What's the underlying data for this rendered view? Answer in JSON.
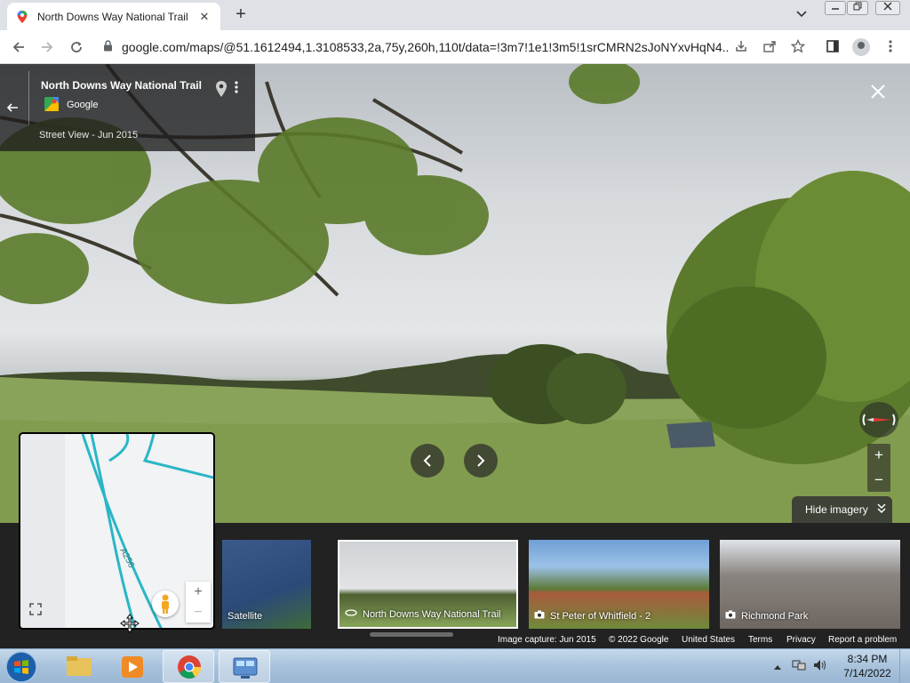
{
  "browser": {
    "tab": {
      "title": "North Downs Way National Trail",
      "close_label": "✕",
      "favicon": "google-maps-pin-icon"
    },
    "new_tab_label": "+",
    "tab_list_label": "⌄",
    "window_controls": {
      "minimize": "—",
      "restore": "❐",
      "close": "✕"
    },
    "url": "google.com/maps/@51.1612494,1.3108533,2a,75y,260h,110t/data=!3m7!1e1!3m5!1srCMRN2sJoNYxvHqN4...",
    "icons": [
      "back-icon",
      "forward-icon",
      "reload-icon",
      "lock-icon",
      "download-icon",
      "share-icon",
      "star-icon",
      "side-panel-icon",
      "profile-icon",
      "menu-icon"
    ]
  },
  "streetview": {
    "place_name": "North Downs Way National Trail",
    "provider": "Google",
    "capture_label": "Street View - Jun 2015",
    "hide_imagery_label": "Hide imagery",
    "close_label": "✕",
    "zoom_in": "+",
    "zoom_out": "−",
    "prev_label": "‹",
    "next_label": "›"
  },
  "imagery": {
    "thumbnails": [
      {
        "label": "Satellite",
        "icon": ""
      },
      {
        "label": "North Downs Way National Trail",
        "icon": "360-icon",
        "selected": true
      },
      {
        "label": "St Peter of Whitfield - 2",
        "icon": "camera-icon"
      },
      {
        "label": "Richmond Park",
        "icon": "camera-icon"
      }
    ]
  },
  "minimap": {
    "road_label": "A256",
    "zoom_in": "+",
    "zoom_out": "−",
    "expand": "⛶"
  },
  "footer": {
    "capture": "Image capture: Jun 2015",
    "copyright": "© 2022 Google",
    "region": "United States",
    "terms": "Terms",
    "privacy": "Privacy",
    "report": "Report a problem"
  },
  "taskbar": {
    "time": "8:34 PM",
    "date": "7/14/2022",
    "apps": [
      "file-explorer-icon",
      "media-player-icon",
      "chrome-icon",
      "control-panel-icon"
    ]
  },
  "colors": {
    "accent_road": "#29b6c6",
    "map_bg": "#f1f3f4",
    "panel_dark": "#222222",
    "taskbar": "#a9c3dd"
  }
}
